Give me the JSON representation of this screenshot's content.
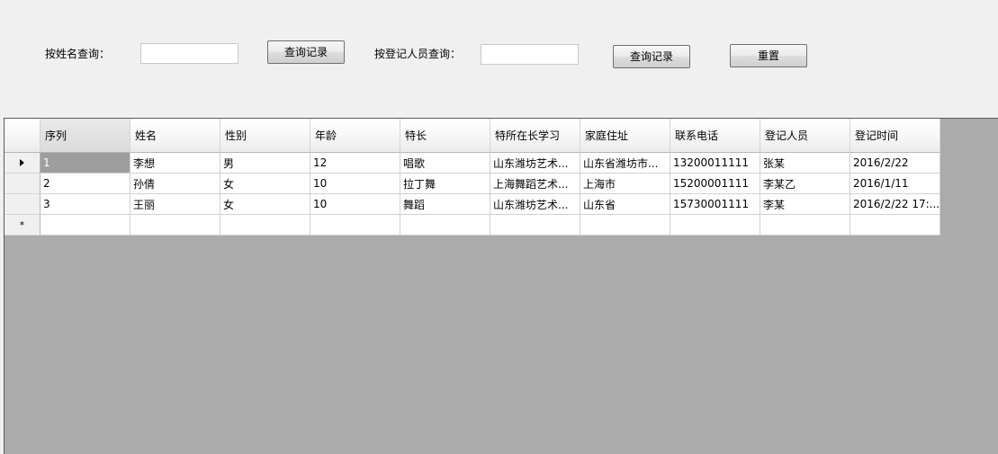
{
  "search": {
    "name_label": "按姓名查询：",
    "name_value": "",
    "name_button": "查询记录",
    "registrar_label": "按登记人员查询：",
    "registrar_value": "",
    "registrar_button": "查询记录",
    "reset_button": "重置"
  },
  "grid": {
    "columns": [
      "序列",
      "姓名",
      "性别",
      "年龄",
      "特长",
      "特所在长学习",
      "家庭住址",
      "联系电话",
      "登记人员",
      "登记时间"
    ],
    "rows": [
      [
        "1",
        "李想",
        "男",
        "12",
        "唱歌",
        "山东潍坊艺术...",
        "山东省潍坊市...",
        "13200011111",
        "张某",
        "2016/2/22"
      ],
      [
        "2",
        "孙倩",
        "女",
        "10",
        "拉丁舞",
        "上海舞蹈艺术...",
        "上海市",
        "15200001111",
        "李某乙",
        "2016/1/11"
      ],
      [
        "3",
        "王丽",
        "女",
        "10",
        "舞蹈",
        "山东潍坊艺术...",
        "山东省",
        "15730001111",
        "李某",
        "2016/2/22 17:..."
      ]
    ],
    "current_row_icon": "row-pointer-arrow",
    "new_row_marker": "*",
    "new_row_icon": "new-row-star",
    "selected_cell_color": "#9e9e9e",
    "background_color": "#ababab"
  }
}
